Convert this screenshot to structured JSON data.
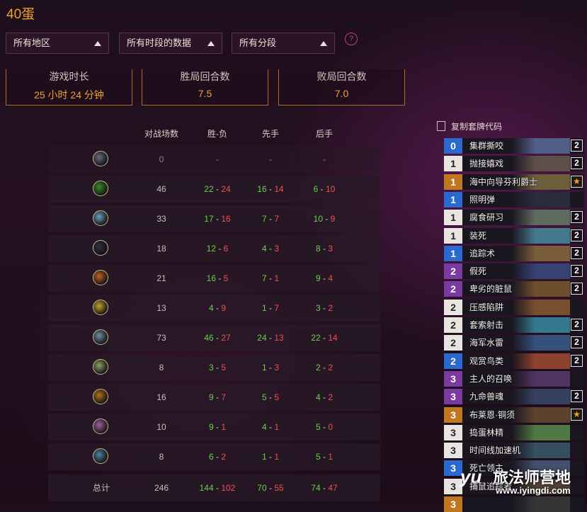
{
  "page_title": "40蛋",
  "filters": {
    "region": "所有地区",
    "period": "所有时段的数据",
    "rank": "所有分段",
    "help": "?"
  },
  "stats": [
    {
      "label": "游戏时长",
      "value": "25 小时 24 分钟"
    },
    {
      "label": "胜局回合数",
      "value": "7.5"
    },
    {
      "label": "败局回合数",
      "value": "7.0"
    }
  ],
  "table": {
    "headers": [
      "对战场数",
      "胜-负",
      "先手",
      "后手"
    ],
    "rows": [
      {
        "icon": "neutral-class-icon",
        "color": "#6a6a80",
        "games": "0",
        "wl": [
          "-",
          "-"
        ],
        "first": [
          "-",
          "-"
        ],
        "second": [
          "-",
          "-"
        ],
        "empty": true
      },
      {
        "icon": "druid-icon",
        "color": "#3a8a2a",
        "games": "46",
        "wl": [
          "22",
          "24"
        ],
        "first": [
          "16",
          "14"
        ],
        "second": [
          "6",
          "10"
        ]
      },
      {
        "icon": "hunter-icon",
        "color": "#6aa0c0",
        "games": "33",
        "wl": [
          "17",
          "16"
        ],
        "first": [
          "7",
          "7"
        ],
        "second": [
          "10",
          "9"
        ]
      },
      {
        "icon": "mage-icon",
        "color": "#303040",
        "games": "18",
        "wl": [
          "12",
          "6"
        ],
        "first": [
          "4",
          "3"
        ],
        "second": [
          "8",
          "3"
        ]
      },
      {
        "icon": "paladin-icon",
        "color": "#c06020",
        "games": "21",
        "wl": [
          "16",
          "5"
        ],
        "first": [
          "7",
          "1"
        ],
        "second": [
          "9",
          "4"
        ]
      },
      {
        "icon": "priest-icon",
        "color": "#c8a030",
        "games": "13",
        "wl": [
          "4",
          "9"
        ],
        "first": [
          "1",
          "7"
        ],
        "second": [
          "3",
          "2"
        ]
      },
      {
        "icon": "rogue-icon",
        "color": "#7090a0",
        "games": "73",
        "wl": [
          "46",
          "27"
        ],
        "first": [
          "24",
          "13"
        ],
        "second": [
          "22",
          "14"
        ]
      },
      {
        "icon": "shaman-icon",
        "color": "#8aa060",
        "games": "8",
        "wl": [
          "3",
          "5"
        ],
        "first": [
          "1",
          "3"
        ],
        "second": [
          "2",
          "2"
        ]
      },
      {
        "icon": "warlock-icon",
        "color": "#b07020",
        "games": "16",
        "wl": [
          "9",
          "7"
        ],
        "first": [
          "5",
          "5"
        ],
        "second": [
          "4",
          "2"
        ]
      },
      {
        "icon": "warrior-icon",
        "color": "#a060a0",
        "games": "10",
        "wl": [
          "9",
          "1"
        ],
        "first": [
          "4",
          "1"
        ],
        "second": [
          "5",
          "0"
        ]
      },
      {
        "icon": "demon-hunter-icon",
        "color": "#5080a0",
        "games": "8",
        "wl": [
          "6",
          "2"
        ],
        "first": [
          "1",
          "1"
        ],
        "second": [
          "5",
          "1"
        ]
      }
    ],
    "total": {
      "label": "总计",
      "games": "246",
      "wl": [
        "144",
        "102"
      ],
      "first": [
        "70",
        "55"
      ],
      "second": [
        "74",
        "47"
      ]
    }
  },
  "deck": {
    "copy_label": "复制套牌代码",
    "cards": [
      {
        "cost": "0",
        "name": "集群撕咬",
        "count": "2",
        "cost_color": "#2a6ad0",
        "art": "#5a6a9a"
      },
      {
        "cost": "1",
        "name": "抛接嬉戏",
        "count": "2",
        "cost_color": "#e8e4e0",
        "art": "#6a5a50"
      },
      {
        "cost": "1",
        "name": "海中向导芬利爵士",
        "count": "★",
        "cost_color": "#c07820",
        "art": "#7a6a40"
      },
      {
        "cost": "1",
        "name": "照明弹",
        "count": "",
        "cost_color": "#2a6ad0",
        "art": "#2a3040"
      },
      {
        "cost": "1",
        "name": "腐食研习",
        "count": "2",
        "cost_color": "#e8e4e0",
        "art": "#6a7a6a"
      },
      {
        "cost": "1",
        "name": "装死",
        "count": "2",
        "cost_color": "#e8e4e0",
        "art": "#4a8aa0"
      },
      {
        "cost": "1",
        "name": "追踪术",
        "count": "2",
        "cost_color": "#2a6ad0",
        "art": "#8a6a40"
      },
      {
        "cost": "2",
        "name": "假死",
        "count": "2",
        "cost_color": "#7a3aa0",
        "art": "#3a4a80"
      },
      {
        "cost": "2",
        "name": "卑劣的脏鼠",
        "count": "2",
        "cost_color": "#7a3aa0",
        "art": "#7a5a30"
      },
      {
        "cost": "2",
        "name": "压感陷阱",
        "count": "",
        "cost_color": "#e8e4e0",
        "art": "#8a5a30"
      },
      {
        "cost": "2",
        "name": "套索射击",
        "count": "2",
        "cost_color": "#e8e4e0",
        "art": "#3a8aa0"
      },
      {
        "cost": "2",
        "name": "海军水雷",
        "count": "2",
        "cost_color": "#e8e4e0",
        "art": "#3a5a8a"
      },
      {
        "cost": "2",
        "name": "观赏鸟类",
        "count": "2",
        "cost_color": "#2a6ad0",
        "art": "#a04a30"
      },
      {
        "cost": "3",
        "name": "主人的召唤",
        "count": "",
        "cost_color": "#7a3aa0",
        "art": "#5a3a6a"
      },
      {
        "cost": "3",
        "name": "九命兽魂",
        "count": "2",
        "cost_color": "#7a3aa0",
        "art": "#3a4a6a"
      },
      {
        "cost": "3",
        "name": "布莱恩·铜须",
        "count": "★",
        "cost_color": "#c07820",
        "art": "#6a4a30"
      },
      {
        "cost": "3",
        "name": "捣蛋林精",
        "count": "",
        "cost_color": "#e8e4e0",
        "art": "#5a8a4a"
      },
      {
        "cost": "3",
        "name": "时间线加速机",
        "count": "",
        "cost_color": "#e8e4e0",
        "art": "#3a5a6a"
      },
      {
        "cost": "3",
        "name": "死亡领主",
        "count": "",
        "cost_color": "#2a6ad0",
        "art": "#4a5a7a"
      },
      {
        "cost": "3",
        "name": "捕鼠追踪者",
        "count": "",
        "cost_color": "#e8e4e0",
        "art": "#5a4a3a"
      },
      {
        "cost": "3",
        "name": "",
        "count": "",
        "cost_color": "#c07820",
        "art": "#3a3a3a"
      }
    ]
  },
  "watermark": {
    "logo": "yu",
    "name": "旅法师营地",
    "url": "www.iyingdi.com"
  }
}
